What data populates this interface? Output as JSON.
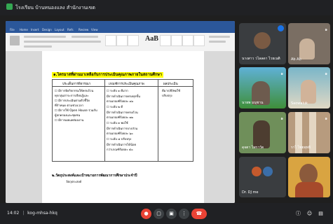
{
  "meeting": {
    "title": "โรงเรียน บ้านหนองแลง สำนักงานเขต",
    "time": "14:02",
    "code": "kog-mhsa-hkq",
    "participants": [
      {
        "name": "นางสาว วไลลดา ไวยเนติ",
        "mic": "๑"
      },
      {
        "name": "Ab Ab",
        "mic": "๑"
      },
      {
        "name": "นายพ มนุชาน",
        "mic": "๑"
      },
      {
        "name": "Saowaluk",
        "mic": "๑"
      },
      {
        "name": "ดุจตา ไพราวัต",
        "mic": "๑"
      },
      {
        "name": "ราไ ไชยพุทธิ",
        "mic": "๑"
      },
      {
        "name": "Dr. DJ me",
        "mic": ""
      },
      {
        "name": "",
        "mic": ""
      }
    ]
  },
  "word": {
    "style_sample": "AaB",
    "menu": [
      "File",
      "Home",
      "Insert",
      "Design",
      "Layout",
      "Refs",
      "Review",
      "View"
    ]
  },
  "document": {
    "heading": "๑.ไตรมาสที่ผ่านมาเหลือกับการประเมินคุณภาพภายในสถานศึกษา",
    "col_headers": [
      "ประเด็นการพิจารณา",
      "เกณฑ์การประเมินคุณภาพ",
      "ผลประเมิน"
    ],
    "col1_lines": [
      "☐ มีการจัดกิจกรรมให้ครบถ้วน",
      "ทุกกลุ่มสาระการเรียนรู้และ",
      "☐ มีการประเมินตามตัวชี้วัด",
      "ที่กำหนด ตามช่วงเวลา",
      "☐ มีการใช้ Open House ร่วมกับ",
      "ผู้ปกครองและชุมชน",
      "☐ มีการเผยแพร่ผลงาน"
    ],
    "col2_lines": [
      "☐ ระดับ ๑ ดีมาก",
      "มีการดำเนินการครบทุกขั้น",
      "ตามเกณฑ์ร้อยละ ๘๐",
      "☐ ระดับ ๒ ดี",
      "มีการดำเนินการครบถ้วน",
      "ตามเกณฑ์ร้อยละ ๗๐",
      "☐ ระดับ ๓ พอใช้",
      "มีการดำเนินการบางส่วน",
      "ตามเกณฑ์ร้อยละ ๖๐",
      "☐ ระดับ ๔ ปรับปรุง",
      "มีการดำเนินการได้น้อย",
      "กว่าเกณฑ์ร้อยละ ๕๐"
    ],
    "col3_lines": [
      "ดีมาก/ดี/พอใช้",
      "ปรับปรุง"
    ],
    "section2_title": "๒.วัตถุประสงค์และเป้าหมายการพัฒนาการศึกษาประจำปี",
    "section2_sub": "วัตถุประสงค์"
  }
}
